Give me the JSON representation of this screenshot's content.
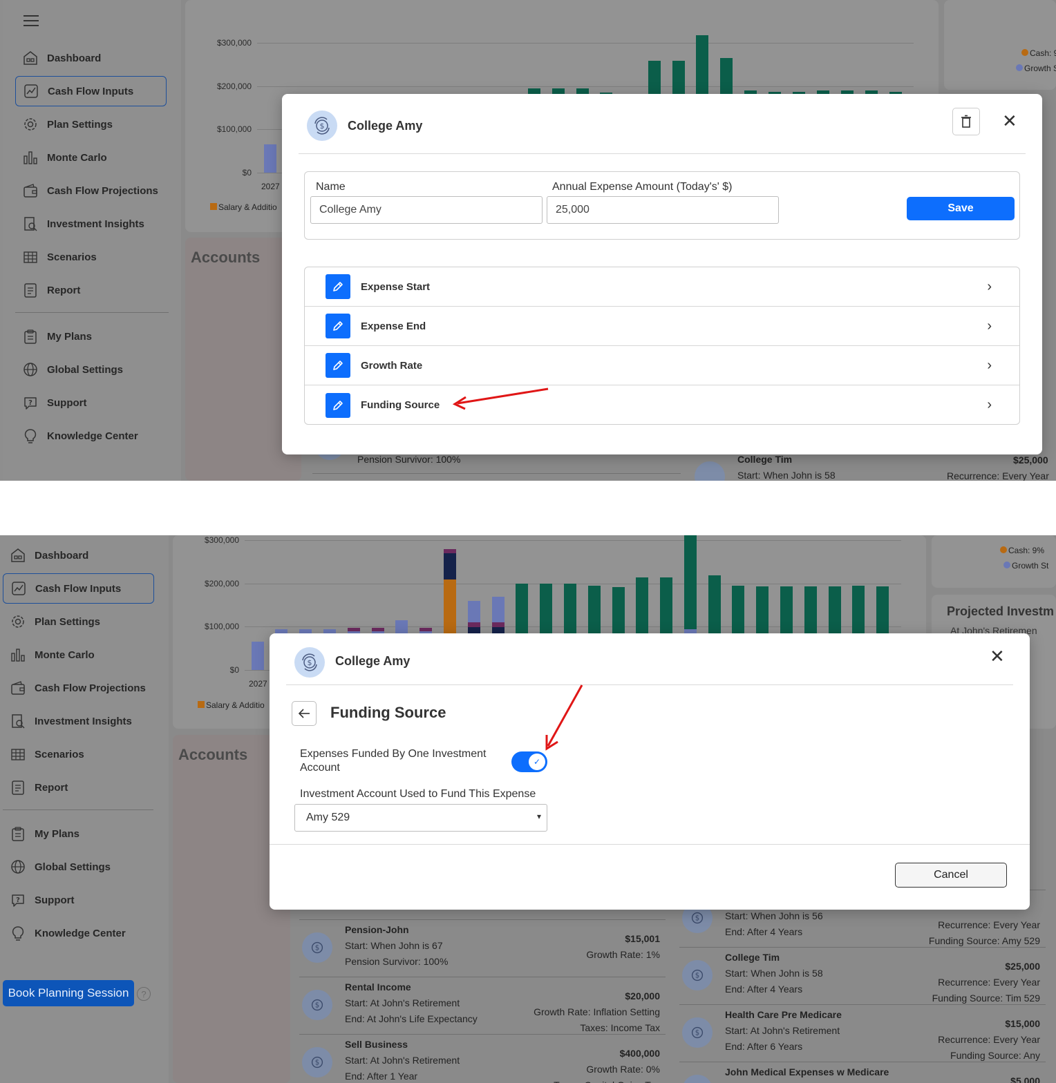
{
  "sidebar": {
    "items": [
      {
        "label": "Dashboard",
        "icon": "dashboard-icon"
      },
      {
        "label": "Cash Flow Inputs",
        "icon": "cash-flow-inputs-icon"
      },
      {
        "label": "Plan Settings",
        "icon": "gear-icon"
      },
      {
        "label": "Monte Carlo",
        "icon": "bar-chart-icon"
      },
      {
        "label": "Cash Flow Projections",
        "icon": "wallet-icon"
      },
      {
        "label": "Investment Insights",
        "icon": "document-search-icon"
      },
      {
        "label": "Scenarios",
        "icon": "scenarios-icon"
      },
      {
        "label": "Report",
        "icon": "report-icon"
      },
      {
        "label": "My Plans",
        "icon": "clipboard-icon"
      },
      {
        "label": "Global Settings",
        "icon": "globe-icon"
      },
      {
        "label": "Support",
        "icon": "help-bubble-icon"
      },
      {
        "label": "Knowledge Center",
        "icon": "lightbulb-icon"
      }
    ],
    "book_session": "Book Planning Session"
  },
  "chart": {
    "ticks": [
      "$300,000",
      "$200,000",
      "$100,000",
      "$0"
    ],
    "first_year": "2027",
    "legend_salary": "Salary & Additio",
    "legend_cash": "Cash: 9%",
    "legend_growth": "Growth S",
    "legend_growth_2": "Growth St"
  },
  "chart_data": {
    "type": "bar",
    "categories_first": "2027",
    "ylim": [
      0,
      320000
    ],
    "series": [
      {
        "name": "Salary & Additio",
        "color": "#b86a12"
      }
    ]
  },
  "background": {
    "accounts_title": "Accounts",
    "projected_title": "Projected Investm",
    "projected_sub": "At John's Retiremen",
    "items": [
      {
        "title": "Pension-John",
        "line1": "Start: When John is 67",
        "line2": "Pension Survivor: 100%",
        "amount": "$15,001",
        "meta1": "Growth Rate: 1%",
        "meta2": ""
      },
      {
        "title": "Rental Income",
        "line1": "Start: At John's Retirement",
        "line2": "End: At John's Life Expectancy",
        "amount": "$20,000",
        "meta1": "Growth Rate: Inflation Setting",
        "meta2": "Taxes: Income Tax"
      },
      {
        "title": "Sell Business",
        "line1": "Start: At John's Retirement",
        "line2": "End: After 1 Year",
        "amount": "$400,000",
        "meta1": "Growth Rate: 0%",
        "meta2": "Taxes: Capital Gains Tax"
      }
    ],
    "right_items": [
      {
        "title": "",
        "line1": "Start: When John is 56",
        "line2": "End: After 4 Years",
        "amount": "",
        "meta1": "Recurrence: Every Year",
        "meta2": "Funding Source: Amy 529"
      },
      {
        "title": "College Tim",
        "line1": "Start: When John is 58",
        "line2": "End: After 4 Years",
        "amount": "$25,000",
        "meta1": "Recurrence: Every Year",
        "meta2": "Funding Source: Tim 529"
      },
      {
        "title": "Health Care Pre Medicare",
        "line1": "Start: At John's Retirement",
        "line2": "End: After 6 Years",
        "amount": "$15,000",
        "meta1": "Recurrence: Every Year",
        "meta2": "Funding Source: Any"
      },
      {
        "title": "John Medical Expenses w Medicare",
        "line1": "",
        "line2": "",
        "amount": "$5,000",
        "meta1": "",
        "meta2": ""
      }
    ],
    "top_pension_line": "Pension Survivor: 100%",
    "top_growth_line": "Growth Rate: 1%",
    "top_college_tim": "College Tim",
    "top_college_tim_start": "Start: When John is 58",
    "top_college_tim_amount": "$25,000",
    "top_college_tim_recur": "Recurrence: Every Year"
  },
  "modal_top": {
    "title": "College Amy",
    "name_label": "Name",
    "name_value": "College Amy",
    "amount_label": "Annual Expense Amount (Today's' $)",
    "amount_value": "25,000",
    "save_label": "Save",
    "rows": [
      "Expense Start",
      "Expense End",
      "Growth Rate",
      "Funding Source"
    ]
  },
  "modal_bottom": {
    "title": "College Amy",
    "section_title": "Funding Source",
    "toggle_label": "Expenses Funded By One Investment Account",
    "toggle_on": true,
    "select_label": "Investment Account Used to Fund This Expense",
    "select_value": "Amy 529",
    "cancel_label": "Cancel"
  },
  "colors": {
    "primary": "#0d6efd",
    "bar_green": "#0b5e4a",
    "bar_navy": "#15224a",
    "bar_blue": "#6a78b6",
    "bar_orange": "#b86a12",
    "bar_purple": "#6b2a5e",
    "annotation_red": "#e01616"
  }
}
